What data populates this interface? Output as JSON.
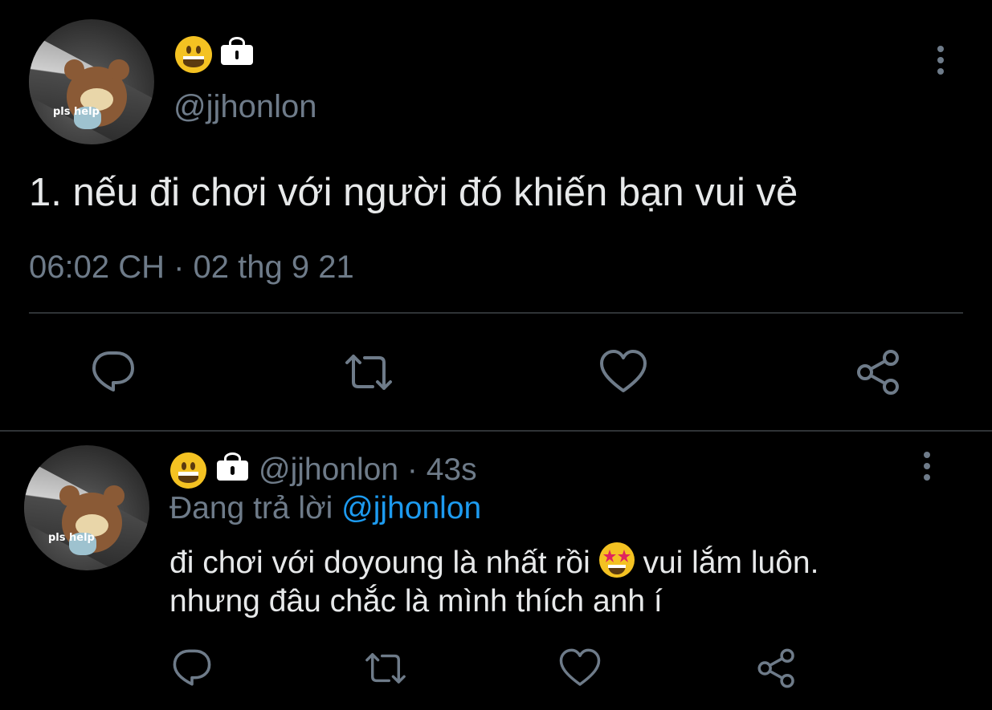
{
  "main_tweet": {
    "avatar_caption": "pls help",
    "display_name_emoji": "grinning-face-emoji",
    "protected_icon": "lock-icon",
    "handle": "@jjhonlon",
    "text": "1. nếu đi chơi với người đó khiến bạn vui vẻ",
    "timestamp": "06:02 CH · 02 thg 9 21",
    "actions": [
      "reply-icon",
      "retweet-icon",
      "like-icon",
      "share-icon"
    ],
    "more_icon": "more-vertical-icon"
  },
  "reply_tweet": {
    "avatar_caption": "pls help",
    "display_name_emoji": "grinning-face-emoji",
    "protected_icon": "lock-icon",
    "handle": "@jjhonlon",
    "separator": "·",
    "age": "43s",
    "replying_prefix": "Đang trả lời",
    "replying_to": "@jjhonlon",
    "text_line1_before": "đi chơi với doyoung là nhất rồi",
    "inline_emoji": "star-struck-emoji",
    "text_line1_after": "vui lắm luôn.",
    "text_line2": "nhưng đâu chắc là mình thích anh í",
    "actions": [
      "reply-icon",
      "retweet-icon",
      "like-icon",
      "share-icon"
    ],
    "more_icon": "more-vertical-icon"
  },
  "colors": {
    "background": "#000000",
    "text": "#d9d9d9",
    "muted": "#6e7b89",
    "link": "#1d9bf0",
    "divider": "#2f3336"
  }
}
